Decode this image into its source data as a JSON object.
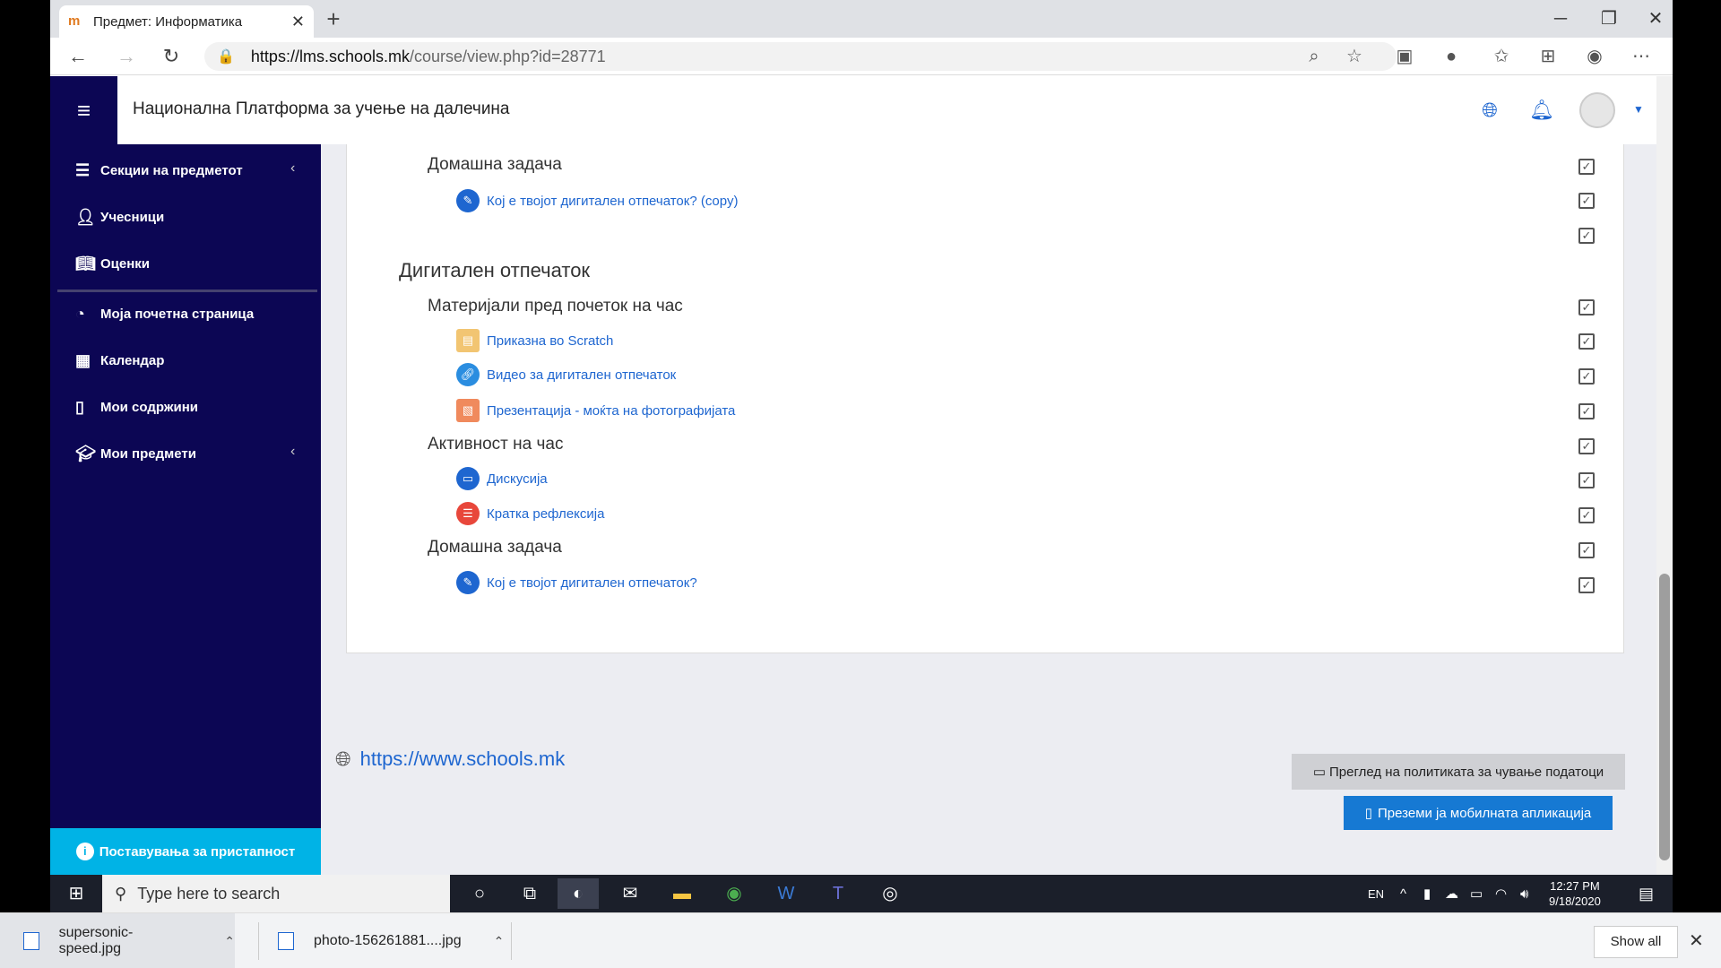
{
  "browser": {
    "tab_title": "Предмет: Информатика",
    "tab_favicon": "m",
    "url_host": "https://lms.schools.mk",
    "url_path": "/course/view.php?id=28771"
  },
  "header": {
    "site_title": "Национална Платформа за учење на далечина"
  },
  "sidebar": {
    "items": [
      {
        "label": "Секции на предметот",
        "icon": "list-icon"
      },
      {
        "label": "Учесници",
        "icon": "users-icon"
      },
      {
        "label": "Оценки",
        "icon": "book-icon"
      },
      {
        "label": "Моја почетна страница",
        "icon": "dashboard-icon"
      },
      {
        "label": "Календар",
        "icon": "calendar-icon"
      },
      {
        "label": "Мои содржини",
        "icon": "file-icon"
      },
      {
        "label": "Мои предмети",
        "icon": "graduation-cap-icon"
      }
    ],
    "accessibility_label": "Поставувања за пристапност"
  },
  "content": {
    "top_subsection": "Домашна задача",
    "top_activity": "Кој е твојот дигитален отпечаток? (copy)",
    "section_title": "Дигитален отпечаток",
    "subsection_1": "Материјали пред почеток на час",
    "activities_1": [
      "Приказна во Scratch",
      "Видео за дигитален отпечаток",
      "Презентација - моќта на фотографијата"
    ],
    "subsection_2": "Активност на час",
    "activities_2": [
      "Дискусија",
      "Кратка рефлексија"
    ],
    "subsection_3": "Домашна задача",
    "activities_3": [
      "Кој е твојот дигитален отпечаток?"
    ]
  },
  "footer": {
    "site_link": "https://www.schools.mk",
    "policy_button": "Преглед на политиката за чување податоци",
    "app_button": "Преземи ја мобилната апликација"
  },
  "taskbar": {
    "search_placeholder": "Type here to search",
    "language": "EN",
    "time": "12:27 PM",
    "date": "9/18/2020"
  },
  "downloads": {
    "items": [
      "supersonic-speed.jpg",
      "photo-156261881....jpg"
    ],
    "show_all": "Show all"
  },
  "colors": {
    "sidebar": "#0c0654",
    "link": "#1e66d0",
    "accessibility": "#00b3e6",
    "app_button": "#1679d3"
  }
}
